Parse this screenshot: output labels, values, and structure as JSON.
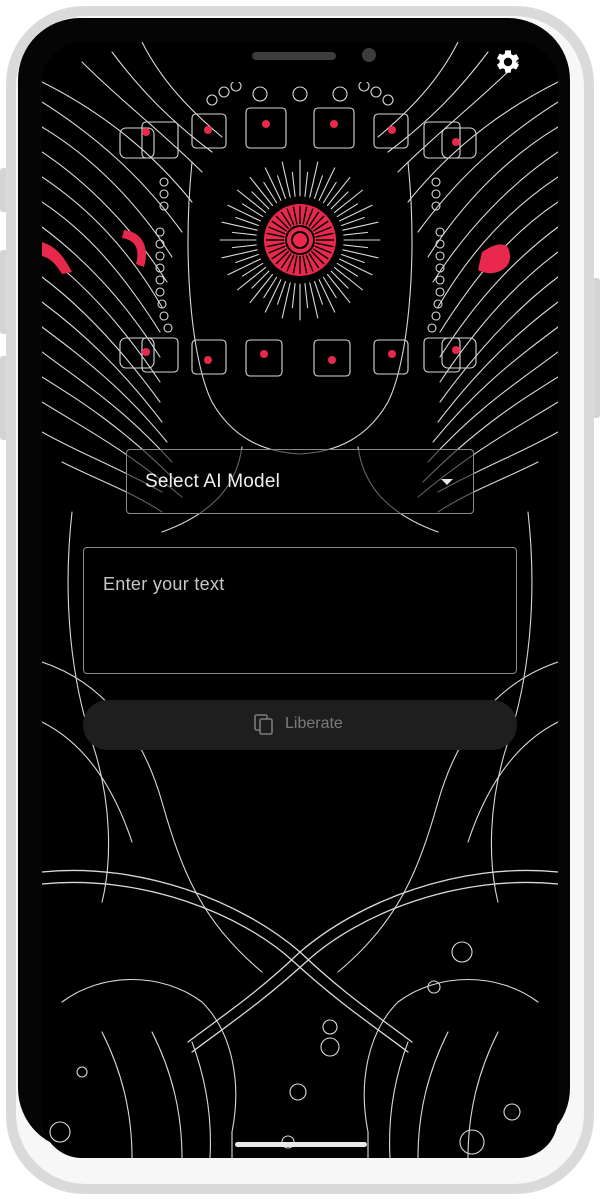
{
  "device": {
    "frame_color": "#dadada",
    "screen_color": "#000000"
  },
  "app": {
    "settings_icon": "gear-icon",
    "model_select": {
      "value": "Select AI Model",
      "icon": "dropdown-arrow-icon"
    },
    "text_input": {
      "placeholder": "Enter your text",
      "value": ""
    },
    "liberate_button": {
      "label": "Liberate",
      "icon": "copy-icon",
      "enabled": false
    },
    "colors": {
      "accent": "#e8294d",
      "line_art": "#d9d9d9",
      "field_border": "#8a8a8a",
      "button_bg": "#1e1e1e",
      "button_text_disabled": "#7b7b7b"
    }
  }
}
